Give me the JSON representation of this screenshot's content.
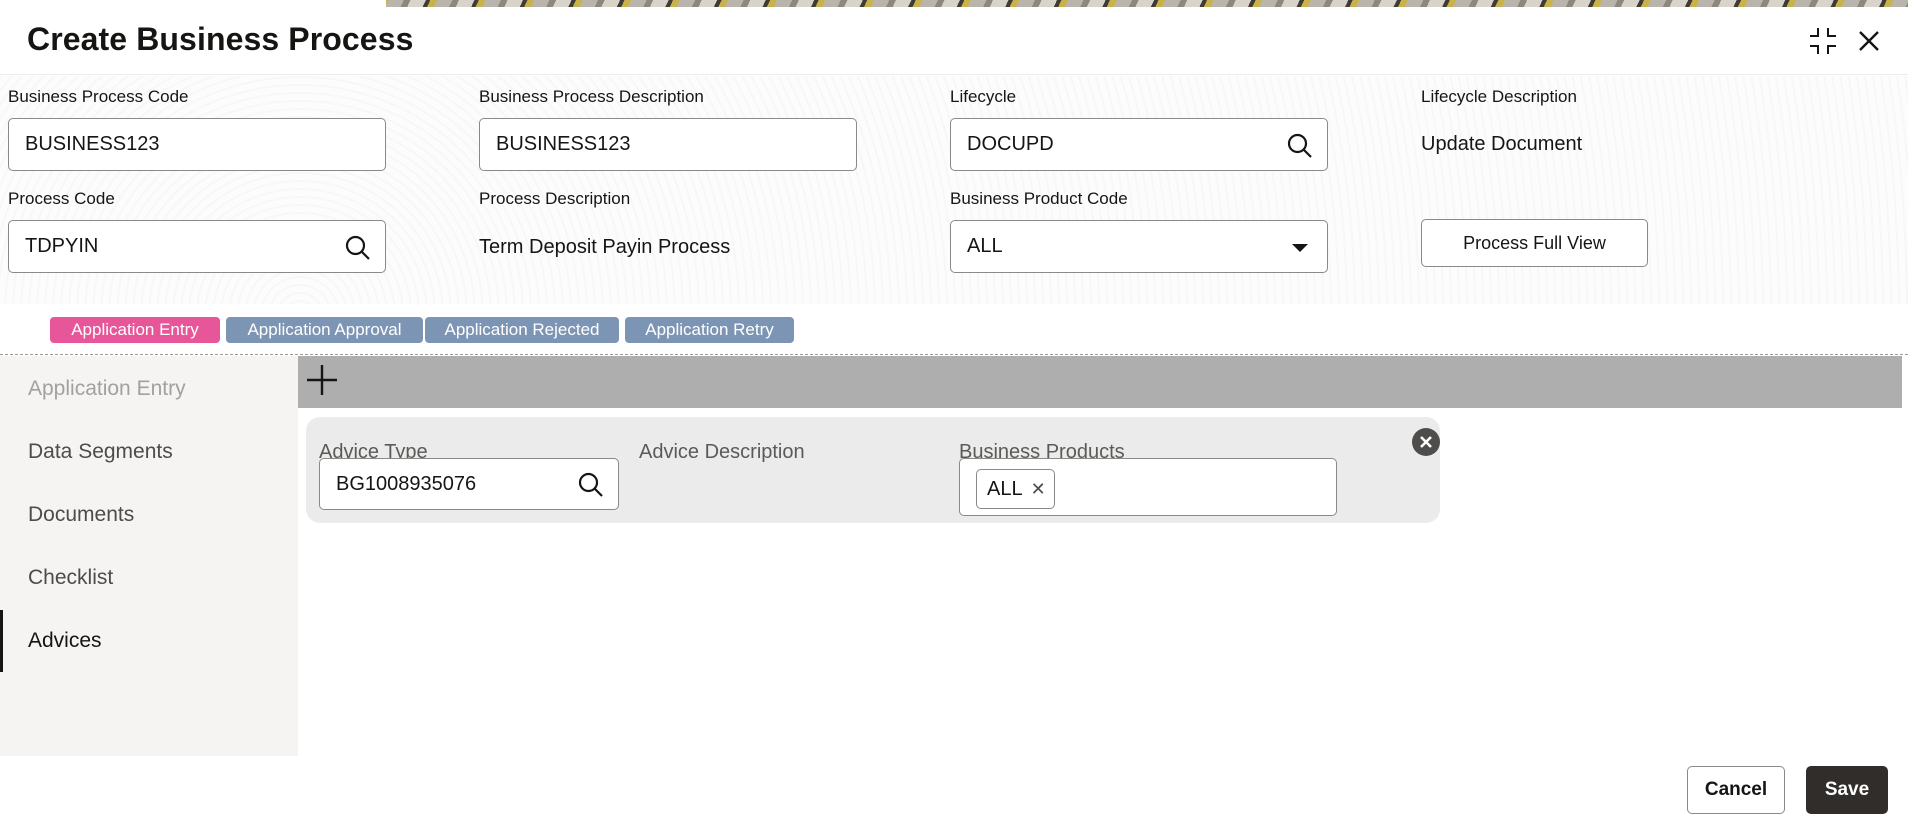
{
  "dialog": {
    "title": "Create Business Process"
  },
  "form": {
    "business_process_code": {
      "label": "Business Process Code",
      "value": "BUSINESS123"
    },
    "business_process_description": {
      "label": "Business Process Description",
      "value": "BUSINESS123"
    },
    "lifecycle": {
      "label": "Lifecycle",
      "value": "DOCUPD"
    },
    "lifecycle_description": {
      "label": "Lifecycle Description",
      "value": "Update Document"
    },
    "process_code": {
      "label": "Process Code",
      "value": "TDPYIN"
    },
    "process_description": {
      "label": "Process Description",
      "value": "Term Deposit Payin Process"
    },
    "business_product_code": {
      "label": "Business Product Code",
      "value": "ALL"
    },
    "process_full_view_label": "Process Full View"
  },
  "stages": [
    {
      "label": "Application Entry",
      "active": true
    },
    {
      "label": "Application Approval",
      "active": false
    },
    {
      "label": "Application Rejected",
      "active": false
    },
    {
      "label": "Application Retry",
      "active": false
    }
  ],
  "sidenav": {
    "items": [
      {
        "label": "Application Entry",
        "state": "disabled"
      },
      {
        "label": "Data Segments",
        "state": "normal"
      },
      {
        "label": "Documents",
        "state": "normal"
      },
      {
        "label": "Checklist",
        "state": "normal"
      },
      {
        "label": "Advices",
        "state": "selected"
      }
    ]
  },
  "advice_card": {
    "advice_type": {
      "label": "Advice Type",
      "value": "BG1008935076"
    },
    "advice_description": {
      "label": "Advice Description"
    },
    "business_products": {
      "label": "Business Products",
      "tags": [
        "ALL"
      ]
    }
  },
  "footer": {
    "cancel_label": "Cancel",
    "save_label": "Save"
  },
  "colors": {
    "active_stage": "#e8569a",
    "inactive_stage": "#7d95b5",
    "primary_button": "#312d2a",
    "toolbar": "#aeaeae"
  }
}
